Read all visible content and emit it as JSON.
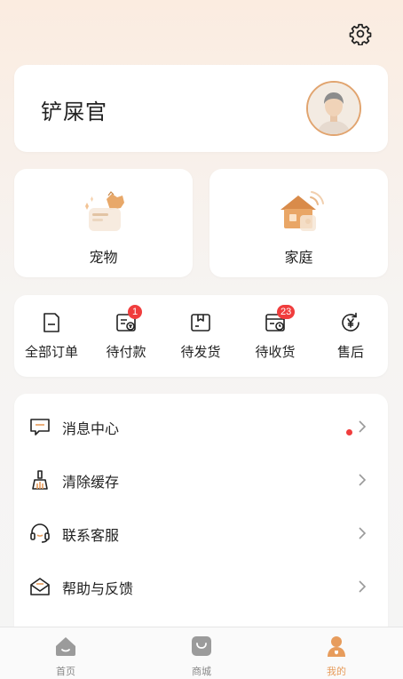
{
  "profile": {
    "username": "铲屎官"
  },
  "tiles": {
    "pet_label": "宠物",
    "home_label": "家庭"
  },
  "orders": [
    {
      "label": "全部订单",
      "badge": ""
    },
    {
      "label": "待付款",
      "badge": "1"
    },
    {
      "label": "待发货",
      "badge": ""
    },
    {
      "label": "待收货",
      "badge": "23"
    },
    {
      "label": "售后",
      "badge": ""
    }
  ],
  "menu": [
    {
      "label": "消息中心",
      "icon": "message-icon",
      "unread_dot": true
    },
    {
      "label": "清除缓存",
      "icon": "broom-icon"
    },
    {
      "label": "联系客服",
      "icon": "headset-icon"
    },
    {
      "label": "帮助与反馈",
      "icon": "mail-icon"
    }
  ],
  "tabbar": [
    {
      "label": "首页",
      "icon": "home-icon"
    },
    {
      "label": "商城",
      "icon": "shop-bag-icon"
    },
    {
      "label": "我的",
      "icon": "profile-icon",
      "active": true
    }
  ],
  "colors": {
    "accent": "#e79c5c",
    "badge": "#f03d3d",
    "avatar_ring": "#e1a46f"
  }
}
